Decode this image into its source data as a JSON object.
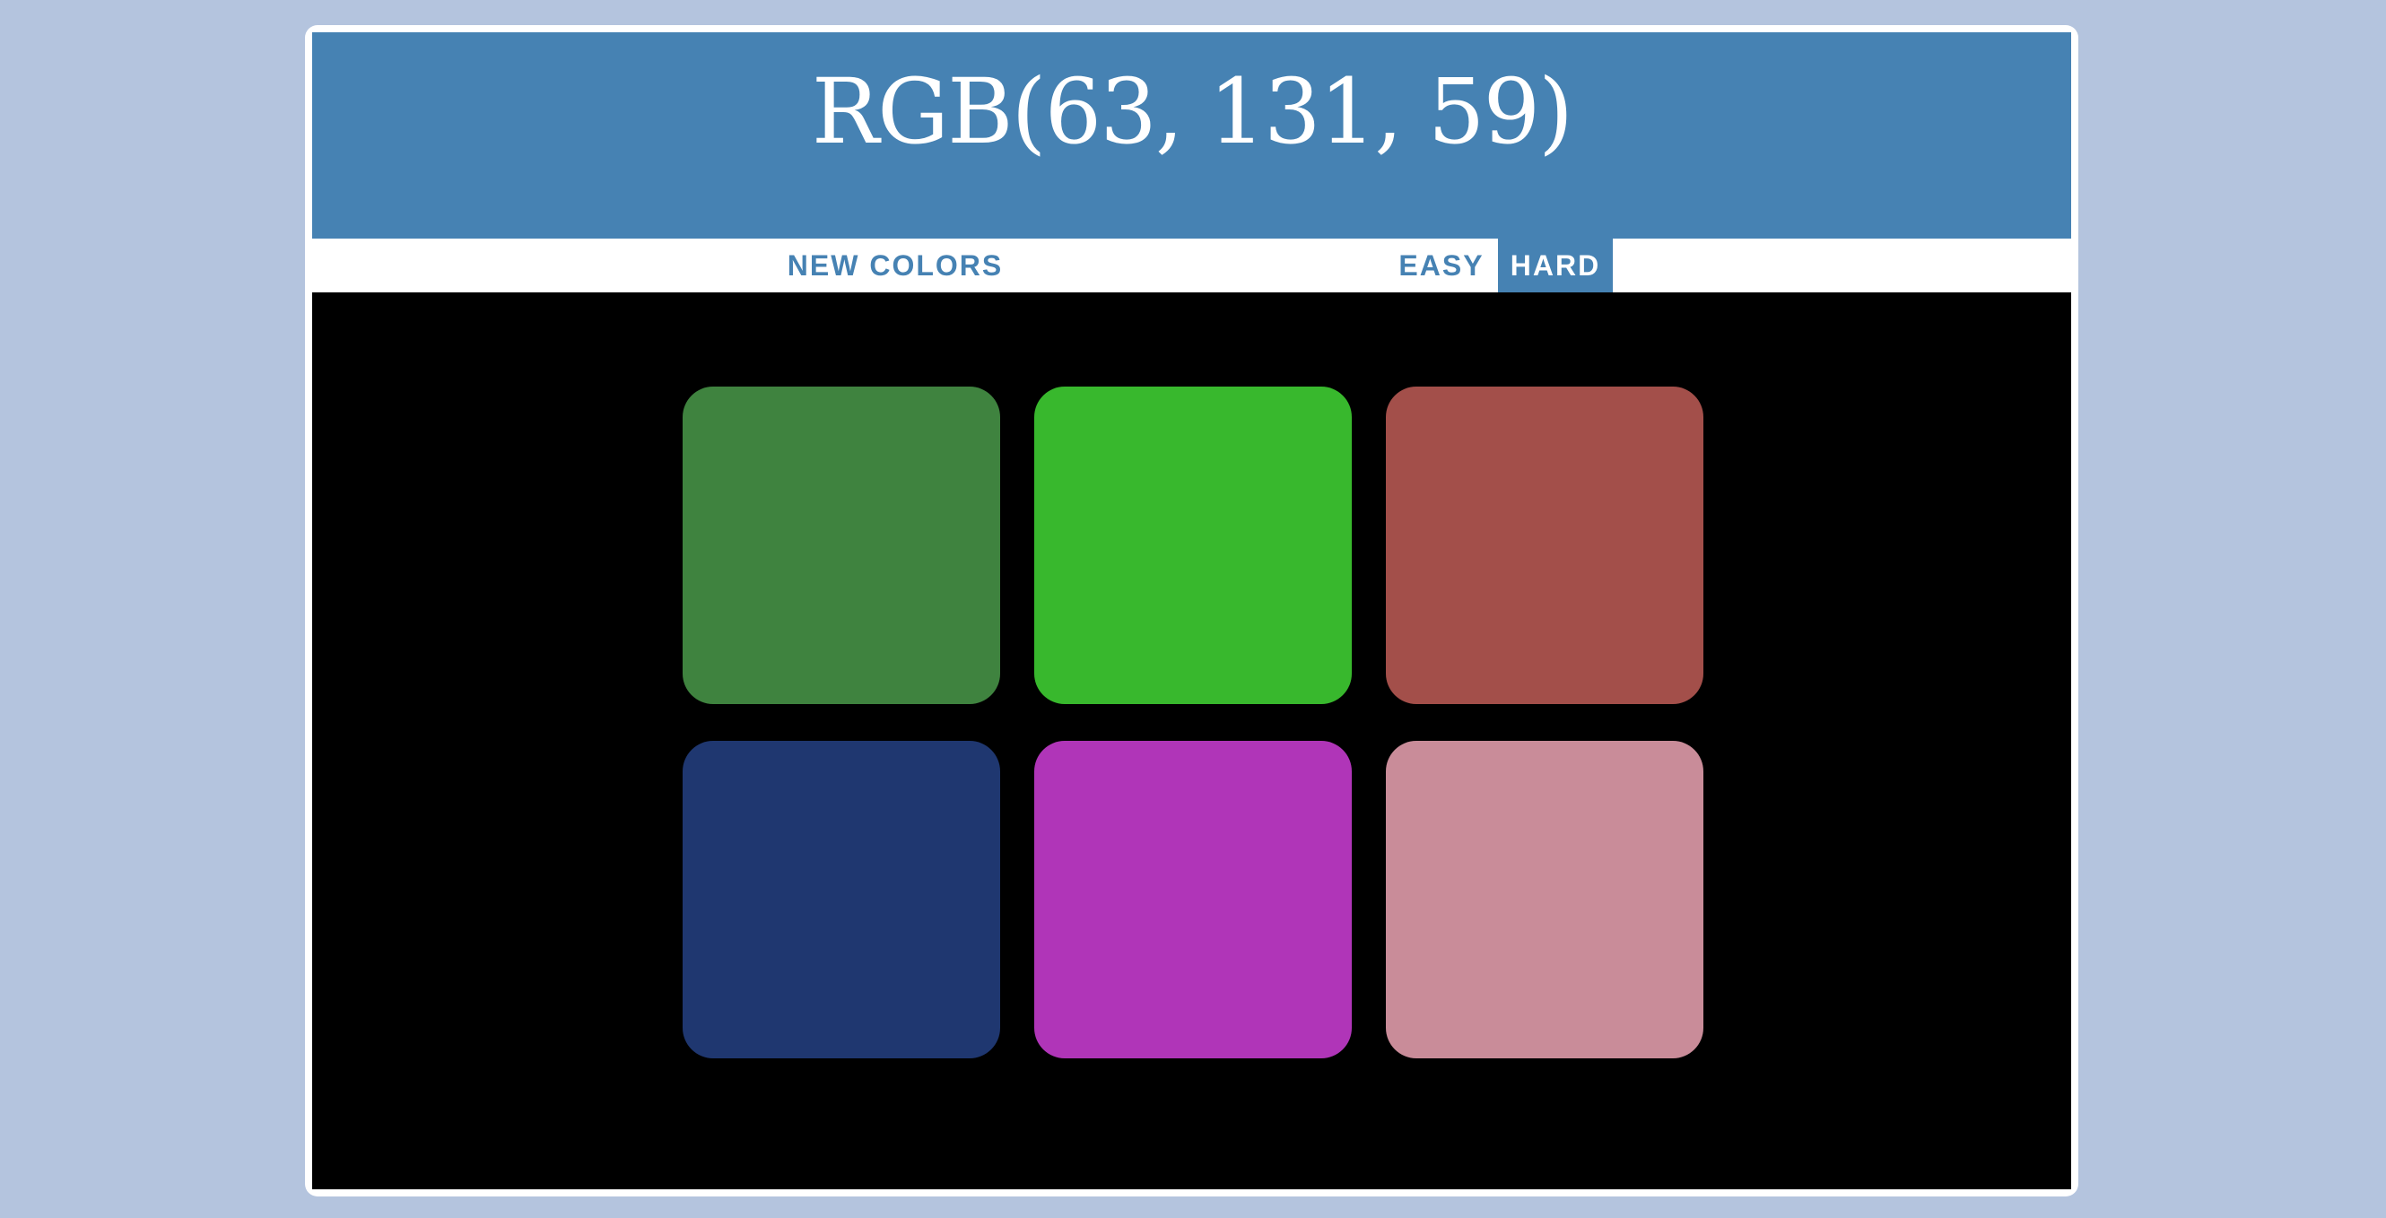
{
  "header": {
    "title": "RGB(63, 131, 59)",
    "background": "#4682b3"
  },
  "controls": {
    "new_colors_label": "NEW COLORS",
    "easy_label": "EASY",
    "hard_label": "HARD",
    "selected_mode": "HARD"
  },
  "board": {
    "background": "#000000",
    "squares": [
      {
        "color": "#3f833f"
      },
      {
        "color": "#38b82d"
      },
      {
        "color": "#a34f4a"
      },
      {
        "color": "#1f3770"
      },
      {
        "color": "#b035b8"
      },
      {
        "color": "#c98c99"
      }
    ]
  }
}
